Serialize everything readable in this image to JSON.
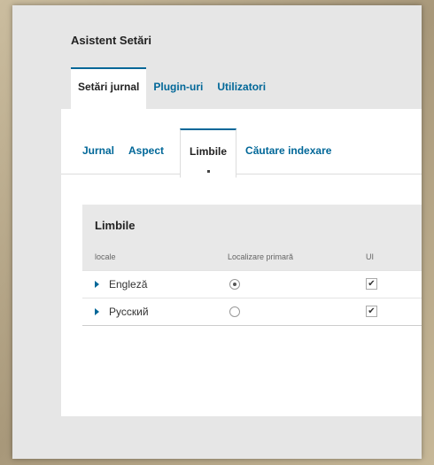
{
  "wizard": {
    "title": "Asistent Setări"
  },
  "main_tabs": [
    {
      "label": "Setări jurnal",
      "active": true
    },
    {
      "label": "Plugin-uri",
      "active": false
    },
    {
      "label": "Utilizatori",
      "active": false
    }
  ],
  "sub_tabs": [
    {
      "label": "Jurnal",
      "active": false
    },
    {
      "label": "Aspect",
      "active": false
    },
    {
      "label": "Limbile",
      "active": true
    },
    {
      "label": "Căutare indexare",
      "active": false
    }
  ],
  "languages": {
    "title": "Limbile",
    "columns": {
      "locale": "locale",
      "primary": "Localizare primară",
      "ui": "UI"
    },
    "rows": [
      {
        "name": "Engleză",
        "primary": true,
        "ui": true
      },
      {
        "name": "Русский",
        "primary": false,
        "ui": true
      }
    ]
  },
  "colors": {
    "accent": "#006798",
    "background": "#e6e6e6"
  },
  "icons": {
    "expand": "triangle-right-icon",
    "check": "check-icon"
  }
}
